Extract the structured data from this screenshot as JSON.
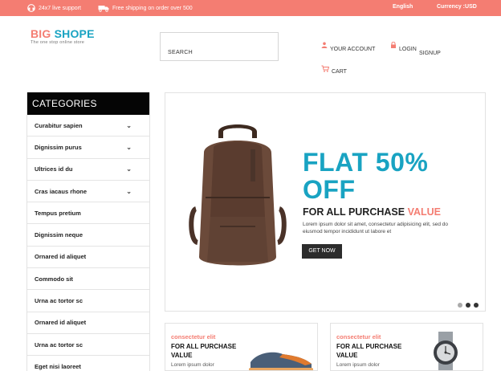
{
  "topbar": {
    "support": "24x7 live support",
    "shipping": "Free shipping on order over 500",
    "language": "English",
    "currency": "Currency :USD"
  },
  "header": {
    "logo_part1": "BIG",
    "logo_part2": "SHOPE",
    "tagline": "The one stop online store",
    "search_label": "SEARCH",
    "account": "YOUR ACCOUNT",
    "login": "LOGIN",
    "signup": "SIGNUP",
    "cart": "CART"
  },
  "categories": {
    "title": "CATEGORIES",
    "items": [
      {
        "label": "Curabitur sapien",
        "chevron": "⌄"
      },
      {
        "label": "Dignissim purus",
        "chevron": "⌄"
      },
      {
        "label": "Ultrices id du",
        "chevron": "⌄"
      },
      {
        "label": "Cras iacaus rhone",
        "chevron": "⌄"
      },
      {
        "label": "Tempus pretium",
        "chevron": ""
      },
      {
        "label": "Dignissim neque",
        "chevron": ""
      },
      {
        "label": "Ornared id aliquet",
        "chevron": ""
      },
      {
        "label": "Commodo sit",
        "chevron": ""
      },
      {
        "label": "Urna ac tortor sc",
        "chevron": ""
      },
      {
        "label": "Ornared id aliquet",
        "chevron": ""
      },
      {
        "label": "Urna ac tortor sc",
        "chevron": ""
      },
      {
        "label": "Eget nisi laoreet",
        "chevron": ""
      }
    ]
  },
  "slider": {
    "headline_line1": "FLAT 50%",
    "headline_line2": "OFF",
    "sub_prefix": "FOR ALL PURCHASE ",
    "sub_highlight": "VALUE",
    "body": "Lorem ipsum dolor sit amet, consectetur adipisicing elit, sed do eiusmod tempor incididunt ut labore et",
    "cta": "GET NOW",
    "active_slide": 2,
    "slide_count": 3
  },
  "cards": [
    {
      "label": "consectetur elit",
      "title": "FOR ALL PURCHASE VALUE",
      "text": "Lorem ipsum dolor"
    },
    {
      "label": "consectetur elit",
      "title": "FOR ALL PURCHASE VALUE",
      "text": "Lorem ipsum dolor"
    }
  ],
  "colors": {
    "accent": "#f47d72",
    "brand_blue": "#19a3c2",
    "dark": "#050505"
  }
}
